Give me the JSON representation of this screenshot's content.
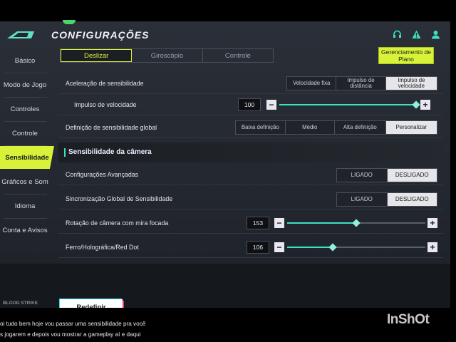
{
  "header": {
    "title": "CONFIGURAÇÕES"
  },
  "sidebar": {
    "items": [
      {
        "label": "Básico"
      },
      {
        "label": "Modo de Jogo"
      },
      {
        "label": "Controles"
      },
      {
        "label": "Controle"
      },
      {
        "label": "Sensibilidade"
      },
      {
        "label": "Gráficos e Som"
      },
      {
        "label": "Idioma"
      },
      {
        "label": "Conta e Avisos"
      }
    ],
    "active_index": 4
  },
  "tabs": [
    {
      "label": "Deslizar"
    },
    {
      "label": "Giroscópio"
    },
    {
      "label": "Controle"
    }
  ],
  "plan_button": "Gerenciamento de Plano",
  "rows": {
    "accel": {
      "label": "Aceleração de sensibilidade",
      "options": [
        "Velocidade fixa",
        "Impulso de distância",
        "Impulso de velocidade"
      ],
      "selected": "Impulso de velocidade"
    },
    "impulse": {
      "label": "Impulso de velocidade",
      "value": "100",
      "fraction": 0.98
    },
    "global_def": {
      "label": "Definição de sensibilidade global",
      "options": [
        "Baixa definição",
        "Médio",
        "Alta definição",
        "Personalizar"
      ],
      "selected": "Personalizar"
    }
  },
  "section": {
    "title": "Sensibilidade da câmera"
  },
  "camera_rows": {
    "advanced": {
      "label": "Configurações Avançadas",
      "on_label": "LIGADO",
      "off_label": "DESLIGADO",
      "selected": "DESLIGADO"
    },
    "sync": {
      "label": "Sincronização Global de Sensibilidade",
      "on_label": "LIGADO",
      "off_label": "DESLIGADO",
      "selected": "DESLIGADO"
    },
    "rotation": {
      "label": "Rotação de câmera com mira focada",
      "value": "153",
      "fraction": 0.5
    },
    "redDot": {
      "label": "Ferro/Holográfica/Red Dot",
      "value": "106",
      "fraction": 0.33
    }
  },
  "reset_button": "Redefinir",
  "brand": "BLOOD STRIKE",
  "caption": {
    "line1": "oi tudo bem hoje vou passar uma sensibilidade pra você",
    "line2": "s jogarem e depois vou mostrar a gameplay aí e daqui"
  },
  "watermark": "InShOt",
  "colors": {
    "accent": "#d8f23a",
    "teal": "#3ee0c0"
  },
  "icons": [
    "headset-icon",
    "user-alert-icon",
    "account-icon"
  ]
}
